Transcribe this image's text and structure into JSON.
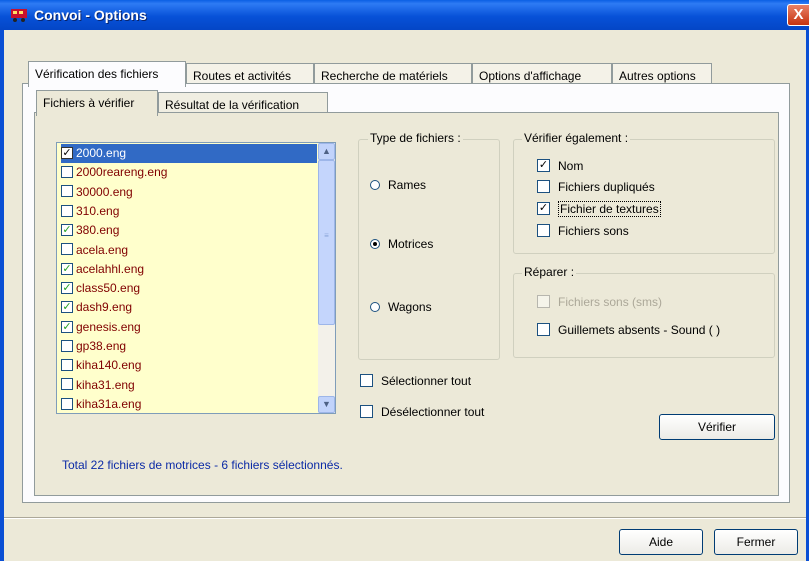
{
  "window": {
    "title": "Convoi - Options",
    "close_glyph": "X"
  },
  "tabs": [
    {
      "label": "Vérification des fichiers",
      "active": true
    },
    {
      "label": "Routes et activités",
      "active": false
    },
    {
      "label": "Recherche de matériels",
      "active": false
    },
    {
      "label": "Options d'affichage",
      "active": false
    },
    {
      "label": "Autres options",
      "active": false
    }
  ],
  "subtabs": [
    {
      "label": "Fichiers à vérifier",
      "active": true
    },
    {
      "label": "Résultat de la vérification",
      "active": false
    }
  ],
  "file_list": {
    "items": [
      {
        "name": "2000.eng",
        "checked": true,
        "selected": true
      },
      {
        "name": "2000reareng.eng",
        "checked": false
      },
      {
        "name": "30000.eng",
        "checked": false
      },
      {
        "name": "310.eng",
        "checked": false
      },
      {
        "name": "380.eng",
        "checked": true
      },
      {
        "name": "acela.eng",
        "checked": false
      },
      {
        "name": "acelahhl.eng",
        "checked": true
      },
      {
        "name": "class50.eng",
        "checked": true
      },
      {
        "name": "dash9.eng",
        "checked": true
      },
      {
        "name": "genesis.eng",
        "checked": true
      },
      {
        "name": "gp38.eng",
        "checked": false
      },
      {
        "name": "kiha140.eng",
        "checked": false
      },
      {
        "name": "kiha31.eng",
        "checked": false
      },
      {
        "name": "kiha31a.eng",
        "checked": false
      }
    ],
    "check_glyph": "✓"
  },
  "file_type": {
    "label": "Type de fichiers :",
    "options": [
      {
        "label": "Rames",
        "selected": false
      },
      {
        "label": "Motrices",
        "selected": true
      },
      {
        "label": "Wagons",
        "selected": false
      }
    ]
  },
  "verify_also": {
    "label": "Vérifier également :",
    "options": [
      {
        "label": "Nom",
        "checked": true
      },
      {
        "label": "Fichiers dupliqués",
        "checked": false
      },
      {
        "label": "Fichier de textures",
        "checked": true
      },
      {
        "label": "Fichiers sons",
        "checked": false
      }
    ]
  },
  "repair": {
    "label": "Réparer :",
    "options": [
      {
        "label": "Fichiers sons (sms)",
        "checked": false,
        "disabled": true
      },
      {
        "label": "Guillemets absents - Sound ( )",
        "checked": false,
        "disabled": false
      }
    ]
  },
  "select_all": {
    "label": "Sélectionner tout",
    "checked": false
  },
  "deselect_all": {
    "label": "Désélectionner tout",
    "checked": false
  },
  "buttons": {
    "verify": "Vérifier",
    "help": "Aide",
    "close": "Fermer"
  },
  "status": "Total 22 fichiers de motrices  -  6 fichiers sélectionnés.",
  "colors": {
    "titlebar": "#0A5FE4",
    "list_background": "#FFFFCC",
    "list_text": "#800000",
    "selection": "#316AC5",
    "status_text": "#0C2BA6"
  }
}
